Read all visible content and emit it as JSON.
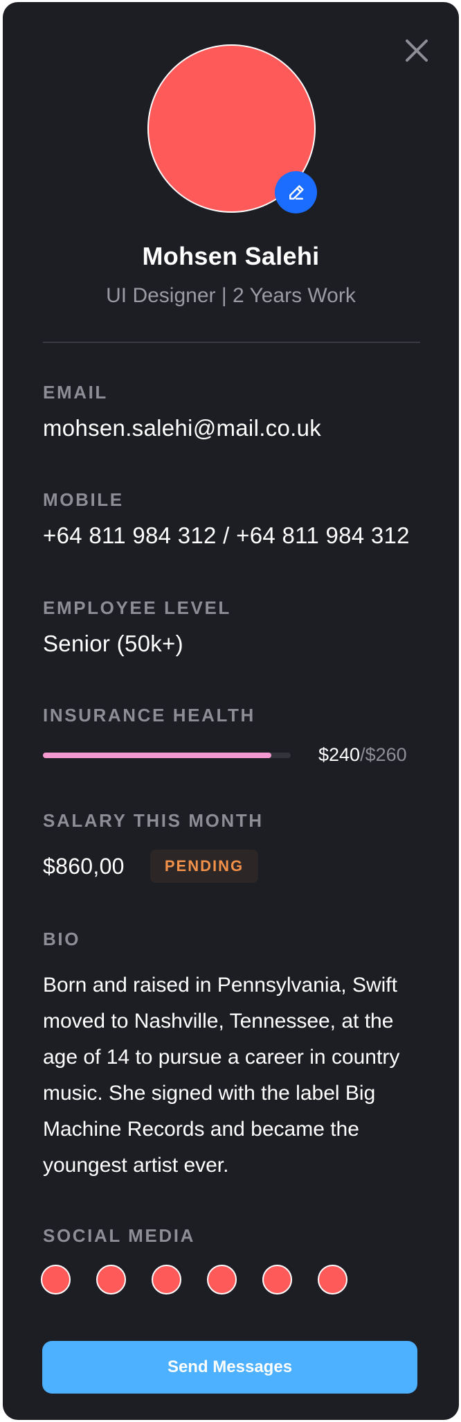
{
  "profile": {
    "name": "Mohsen Salehi",
    "role": "UI Designer | 2 Years Work"
  },
  "fields": {
    "email": {
      "label": "EMAIL",
      "value": "mohsen.salehi@mail.co.uk"
    },
    "mobile": {
      "label": "MOBILE",
      "value": "+64 811 984 312 / +64 811 984 312"
    },
    "employee_level": {
      "label": "EMPLOYEE LEVEL",
      "value": "Senior (50k+)"
    },
    "insurance": {
      "label": "INSURANCE HEALTH",
      "current": "$240",
      "max": "/$260",
      "progress_fraction": 0.923
    },
    "salary": {
      "label": "SALARY THIS MONTH",
      "value": "$860,00",
      "status": "PENDING"
    },
    "bio": {
      "label": "BIO",
      "text": "Born and raised in Pennsylvania, Swift moved to Nashville, Tennessee, at the age of 14 to pursue a career in country music. She signed with the label Big Machine Records and became the youngest artist ever."
    },
    "social": {
      "label": "SOCIAL MEDIA",
      "count": 6
    }
  },
  "actions": {
    "send_label": "Send Messages"
  },
  "icons": {
    "close": "close-icon",
    "edit": "pencil-icon"
  },
  "colors": {
    "background": "#1d1d24",
    "avatar": "#ff5a5a",
    "edit_button": "#1a6dff",
    "progress": "#f59ad0",
    "pending": "#f2914a",
    "send_button": "#4db1ff"
  }
}
